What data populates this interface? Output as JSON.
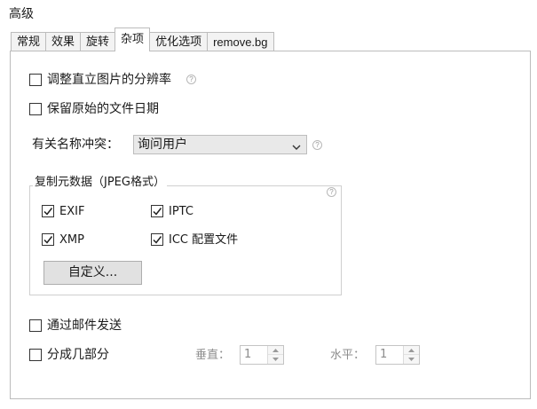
{
  "section": {
    "title": "高级"
  },
  "tabs": [
    {
      "label": "常规"
    },
    {
      "label": "效果"
    },
    {
      "label": "旋转"
    },
    {
      "label": "杂项",
      "active": true
    },
    {
      "label": "优化选项"
    },
    {
      "label": "remove.bg"
    }
  ],
  "options": {
    "adjust_resolution": {
      "label": "调整直立图片的分辨率",
      "checked": false
    },
    "keep_file_date": {
      "label": "保留原始的文件日期",
      "checked": false
    }
  },
  "name_conflict": {
    "label": "有关名称冲突：",
    "value": "询问用户"
  },
  "metadata": {
    "title": "复制元数据（JPEG格式）",
    "exif": {
      "label": "EXIF",
      "checked": true
    },
    "iptc": {
      "label": "IPTC",
      "checked": true
    },
    "xmp": {
      "label": "XMP",
      "checked": true
    },
    "icc": {
      "label": "ICC 配置文件",
      "checked": true
    },
    "custom_button": "自定义..."
  },
  "send_email": {
    "label": "通过邮件发送",
    "checked": false
  },
  "split": {
    "label": "分成几部分",
    "checked": false,
    "vertical_label": "垂直：",
    "vertical_value": "1",
    "horizontal_label": "水平：",
    "horizontal_value": "1"
  },
  "help_glyph": "?",
  "icons": {
    "help": "question-circle-icon",
    "check": "checkmark-icon",
    "dropdown": "chevron-down-icon",
    "spin_up": "triangle-up-icon",
    "spin_down": "triangle-down-icon"
  },
  "colors": {
    "border": "#bcbcbc",
    "combo_bg": "#e9e9e9",
    "button_bg": "#e1e1e1",
    "disabled_text": "#8c8c8c"
  }
}
